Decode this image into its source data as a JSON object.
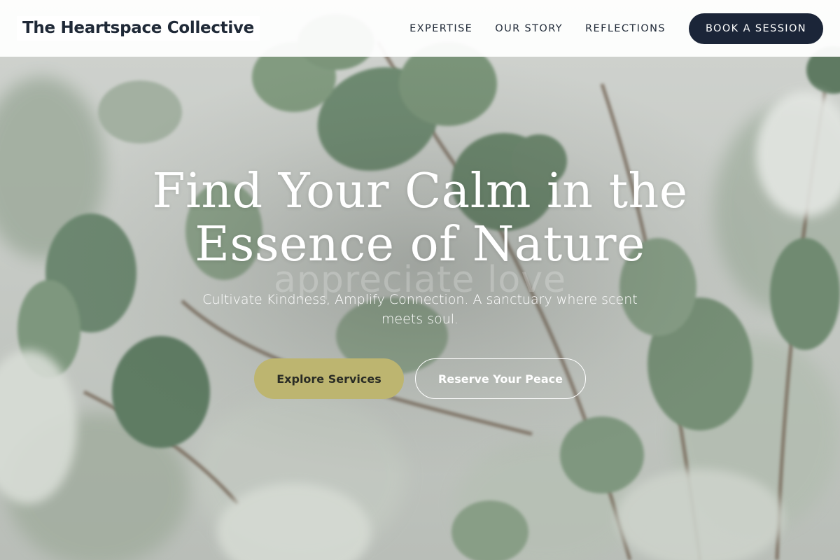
{
  "brand": {
    "name": "The Heartspace Collective"
  },
  "nav": {
    "items": [
      {
        "label": "EXPERTISE"
      },
      {
        "label": "OUR STORY"
      },
      {
        "label": "REFLECTIONS"
      }
    ],
    "cta_label": "BOOK A SESSION"
  },
  "hero": {
    "title_line1": "Find Your Calm in the",
    "title_line2": "Essence of Nature",
    "ghost_text": "appreciate love",
    "subtitle": "Cultivate Kindness, Amplify Connection. A sanctuary where scent meets soul.",
    "primary_button": "Explore Services",
    "secondary_button": "Reserve Your Peace"
  },
  "colors": {
    "header_bg": "#ffffff",
    "cta_bg": "#1b2538",
    "primary_button_bg": "#bdb570",
    "text_dark": "#1f2937",
    "leaf_green": "#6f8a72"
  },
  "background": {
    "image": "eucalyptus-leaves-photo"
  }
}
